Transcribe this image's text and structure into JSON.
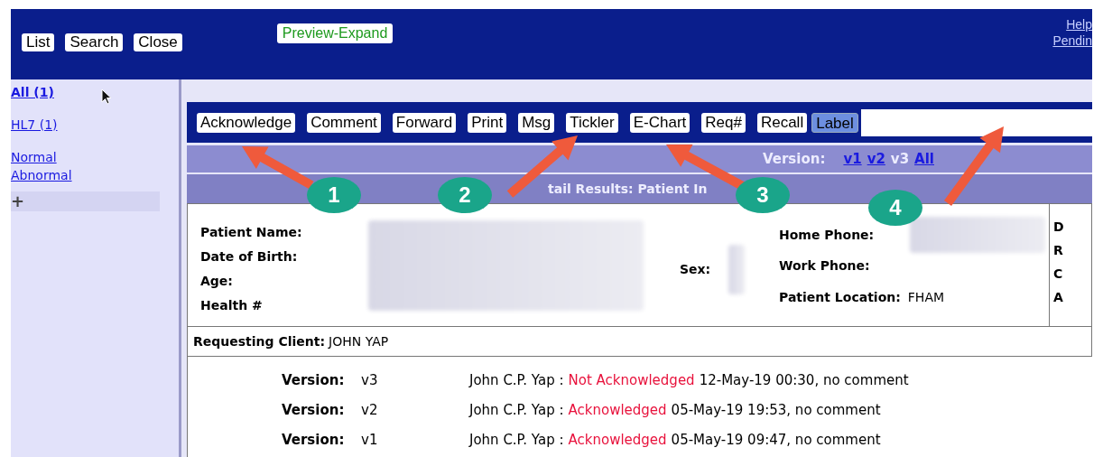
{
  "top_bar": {
    "buttons": [
      "List",
      "Search",
      "Close"
    ],
    "preview_button": "Preview-Expand",
    "links": [
      "Help",
      "Pendin"
    ]
  },
  "sidebar": {
    "items": [
      {
        "label": "All (1)",
        "selected": true
      },
      {
        "label": "HL7 (1)",
        "selected": false
      },
      {
        "label": "Normal",
        "selected": false
      },
      {
        "label": "Abnormal",
        "selected": false
      }
    ],
    "add_label": "+"
  },
  "toolbar": {
    "buttons": [
      {
        "label": "Acknowledge",
        "highlighted": false
      },
      {
        "label": "Comment",
        "highlighted": false
      },
      {
        "label": "Forward",
        "highlighted": false
      },
      {
        "label": "Print",
        "highlighted": false
      },
      {
        "label": "Msg",
        "highlighted": false
      },
      {
        "label": "Tickler",
        "highlighted": false
      },
      {
        "label": "E-Chart",
        "highlighted": false
      },
      {
        "label": "Req#",
        "highlighted": false
      },
      {
        "label": "Recall",
        "highlighted": false
      },
      {
        "label": "Label",
        "highlighted": true
      }
    ]
  },
  "version_bar": {
    "label": "Version:",
    "versions": [
      {
        "label": "v1",
        "selected": false
      },
      {
        "label": "v2",
        "selected": false
      },
      {
        "label": "v3",
        "selected": true
      },
      {
        "label": "All",
        "selected": false
      }
    ]
  },
  "section_heading": "tail Results: Patient In",
  "patient": {
    "left_labels": [
      "Patient Name:",
      "Date of Birth:",
      "Age:",
      "Health #"
    ],
    "sex_label": "Sex:",
    "right_fields": [
      {
        "label": "Home Phone:"
      },
      {
        "label": "Work Phone:"
      },
      {
        "label": "Patient Location:",
        "value": "FHAM"
      }
    ],
    "column_3": [
      "D",
      "R",
      "C",
      "A"
    ]
  },
  "requesting_client": {
    "label": "Requesting Client:",
    "value": "JOHN YAP"
  },
  "versions": [
    {
      "label": "Version:",
      "value": "v3",
      "reviewer": "John C.P. Yap :",
      "status": "Not Acknowledged",
      "detail": "12-May-19 00:30, no comment"
    },
    {
      "label": "Version:",
      "value": "v2",
      "reviewer": "John C.P. Yap :",
      "status": "Acknowledged",
      "detail": "05-May-19 19:53, no comment"
    },
    {
      "label": "Version:",
      "value": "v1",
      "reviewer": "John C.P. Yap :",
      "status": "Acknowledged",
      "detail": "05-May-19 09:47, no comment"
    }
  ],
  "callouts": [
    "1",
    "2",
    "3",
    "4"
  ]
}
